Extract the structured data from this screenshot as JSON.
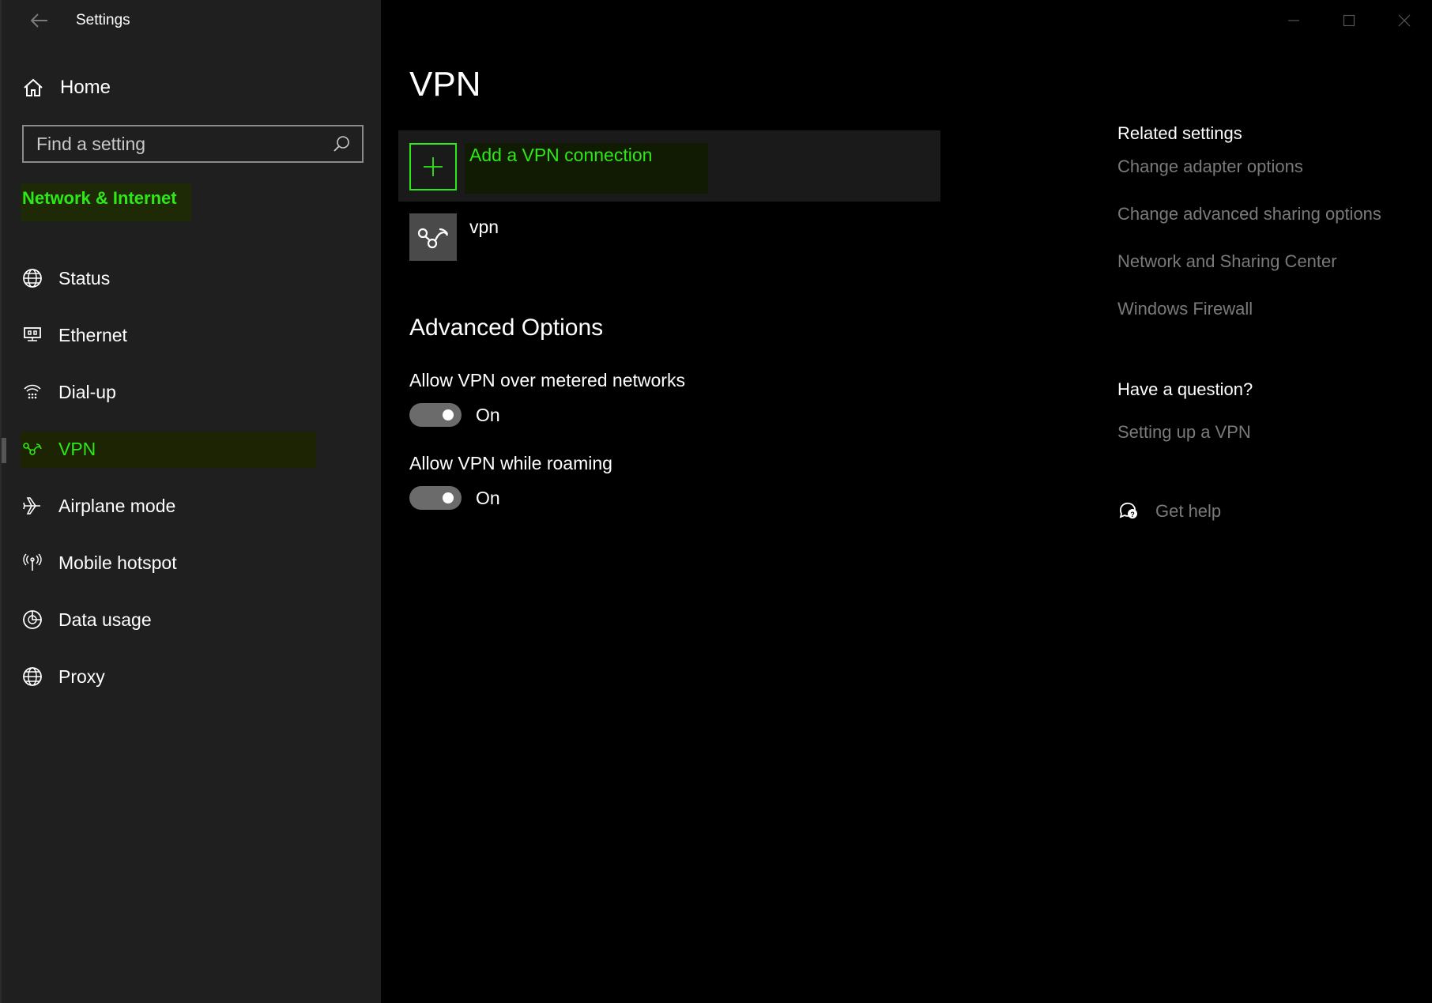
{
  "window": {
    "title": "Settings",
    "controls": [
      "minimize-icon",
      "maximize-icon",
      "close-icon"
    ]
  },
  "sidebar": {
    "home_label": "Home",
    "search": {
      "placeholder": "Find a setting",
      "value": ""
    },
    "section_title": "Network & Internet",
    "items": [
      {
        "label": "Status",
        "icon": "globe-status-icon",
        "active": false
      },
      {
        "label": "Ethernet",
        "icon": "ethernet-icon",
        "active": false
      },
      {
        "label": "Dial-up",
        "icon": "dialup-icon",
        "active": false
      },
      {
        "label": "VPN",
        "icon": "vpn-icon",
        "active": true
      },
      {
        "label": "Airplane mode",
        "icon": "airplane-icon",
        "active": false
      },
      {
        "label": "Mobile hotspot",
        "icon": "hotspot-icon",
        "active": false
      },
      {
        "label": "Data usage",
        "icon": "data-usage-icon",
        "active": false
      },
      {
        "label": "Proxy",
        "icon": "proxy-globe-icon",
        "active": false
      }
    ]
  },
  "main": {
    "title": "VPN",
    "add_connection_label": "Add a VPN connection",
    "connections": [
      {
        "name": "vpn"
      }
    ],
    "advanced_title": "Advanced Options",
    "options": [
      {
        "label": "Allow VPN over metered networks",
        "state": "On",
        "on": true
      },
      {
        "label": "Allow VPN while roaming",
        "state": "On",
        "on": true
      }
    ]
  },
  "right_panel": {
    "related_title": "Related settings",
    "related_links": [
      "Change adapter options",
      "Change advanced sharing options",
      "Network and Sharing Center",
      "Windows Firewall"
    ],
    "question_title": "Have a question?",
    "question_link": "Setting up a VPN",
    "get_help": "Get help"
  },
  "colors": {
    "accent": "#2fe817",
    "sidebar_bg": "#1f1f1f",
    "main_bg": "#000000",
    "muted_link": "#7a7a7a"
  }
}
